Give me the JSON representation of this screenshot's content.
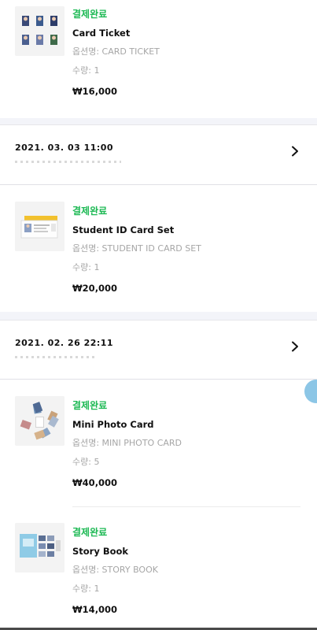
{
  "orders": [
    {
      "products": [
        {
          "status": "결제완료",
          "name": "Card Ticket",
          "option": "옵션명: CARD TICKET",
          "qty": "수량: 1",
          "price": "₩16,000",
          "thumb_icon": "card-ticket-thumbnail"
        }
      ]
    },
    {
      "date": "2021. 03. 03 11:00",
      "products": [
        {
          "status": "결제완료",
          "name": "Student ID Card Set",
          "option": "옵션명: STUDENT ID CARD SET",
          "qty": "수량: 1",
          "price": "₩20,000",
          "thumb_icon": "student-id-card-thumbnail"
        }
      ]
    },
    {
      "date": "2021. 02. 26 22:11",
      "products": [
        {
          "status": "결제완료",
          "name": "Mini Photo Card",
          "option": "옵션명: MINI PHOTO CARD",
          "qty": "수량: 5",
          "price": "₩40,000",
          "thumb_icon": "mini-photo-card-thumbnail"
        },
        {
          "status": "결제완료",
          "name": "Story Book",
          "option": "옵션명: STORY BOOK",
          "qty": "수량: 1",
          "price": "₩14,000",
          "thumb_icon": "story-book-thumbnail"
        }
      ]
    }
  ],
  "colors": {
    "status_green": "#1db954",
    "muted_text": "#a6a6a6",
    "band_bg": "#f3f4f9"
  },
  "icons": {
    "chevron": "chevron-right-icon"
  }
}
